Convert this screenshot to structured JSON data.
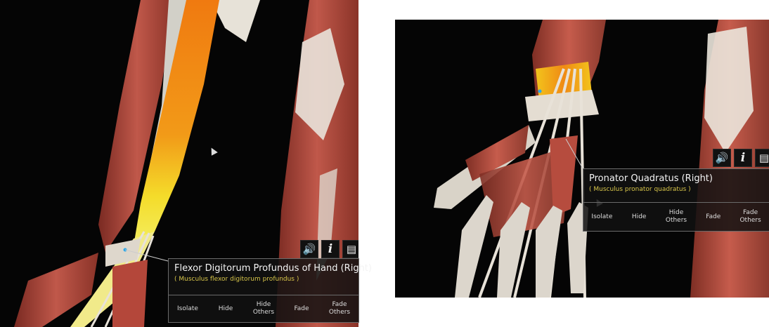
{
  "left_view": {
    "structure_title": "Flexor Digitorum Profundus of Hand (Right)",
    "latin_name": "( Musculus flexor digitorum profundus )",
    "actions": [
      "Isolate",
      "Hide",
      "Hide\nOthers",
      "Fade",
      "Fade\nOthers"
    ],
    "icons": [
      "speaker-icon",
      "info-icon",
      "notes-icon"
    ]
  },
  "right_view": {
    "structure_title": "Pronator Quadratus (Right)",
    "latin_name": "( Musculus pronator quadratus )",
    "actions": [
      "Isolate",
      "Hide",
      "Hide\nOthers",
      "Fade",
      "Fade\nOthers"
    ],
    "icons": [
      "speaker-icon",
      "info-icon",
      "notes-icon"
    ]
  },
  "colors": {
    "background": "#050505",
    "muscle": "#b5483a",
    "highlight_orange": "#f08a10",
    "highlight_yellow": "#f2e23a",
    "tendon": "#e8e2d8",
    "latin_text": "#d8c64a"
  }
}
